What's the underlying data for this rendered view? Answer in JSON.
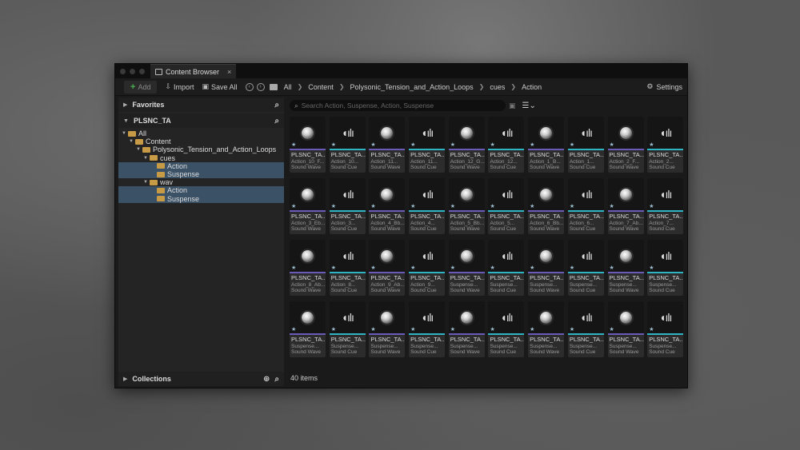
{
  "window": {
    "tab_title": "Content Browser",
    "tab_close": "×"
  },
  "toolbar": {
    "add_label": "Add",
    "import_label": "Import",
    "save_all_label": "Save All",
    "breadcrumbs": [
      "All",
      "Content",
      "Polysonic_Tension_and_Action_Loops",
      "cues",
      "Action"
    ],
    "settings_label": "Settings"
  },
  "left": {
    "favorites_label": "Favorites",
    "project_label": "PLSNC_TA",
    "tree": [
      {
        "label": "All",
        "depth": 0,
        "selected": false,
        "expanded": true
      },
      {
        "label": "Content",
        "depth": 1,
        "selected": false,
        "expanded": true
      },
      {
        "label": "Polysonic_Tension_and_Action_Loops",
        "depth": 2,
        "selected": false,
        "expanded": true
      },
      {
        "label": "cues",
        "depth": 3,
        "selected": false,
        "expanded": true
      },
      {
        "label": "Action",
        "depth": 4,
        "selected": true,
        "expanded": false
      },
      {
        "label": "Suspense",
        "depth": 4,
        "selected": true,
        "expanded": false
      },
      {
        "label": "wav",
        "depth": 3,
        "selected": false,
        "expanded": true
      },
      {
        "label": "Action",
        "depth": 4,
        "selected": true,
        "expanded": false
      },
      {
        "label": "Suspense",
        "depth": 4,
        "selected": true,
        "expanded": false
      }
    ],
    "collections_label": "Collections"
  },
  "search": {
    "placeholder": "Search Action, Suspense, Action, Suspense"
  },
  "status": {
    "items_count": "40 items"
  },
  "assets": [
    {
      "name": "PLSNC_TA...",
      "sub1": "Action_10_F...",
      "type": "Sound Wave",
      "kind": "wave"
    },
    {
      "name": "PLSNC_TA...",
      "sub1": "Action_10...",
      "type": "Sound Cue",
      "kind": "cue"
    },
    {
      "name": "PLSNC_TA...",
      "sub1": "Action_11...",
      "type": "Sound Wave",
      "kind": "wave"
    },
    {
      "name": "PLSNC_TA...",
      "sub1": "Action_11...",
      "type": "Sound Cue",
      "kind": "cue"
    },
    {
      "name": "PLSNC_TA...",
      "sub1": "Action_12_G...",
      "type": "Sound Wave",
      "kind": "wave"
    },
    {
      "name": "PLSNC_TA...",
      "sub1": "Action_12...",
      "type": "Sound Cue",
      "kind": "cue"
    },
    {
      "name": "PLSNC_TA...",
      "sub1": "Action_1_B...",
      "type": "Sound Wave",
      "kind": "wave"
    },
    {
      "name": "PLSNC_TA...",
      "sub1": "Action_1...",
      "type": "Sound Cue",
      "kind": "cue"
    },
    {
      "name": "PLSNC_TA...",
      "sub1": "Action_2_F...",
      "type": "Sound Wave",
      "kind": "wave"
    },
    {
      "name": "PLSNC_TA...",
      "sub1": "Action_2...",
      "type": "Sound Cue",
      "kind": "cue"
    },
    {
      "name": "PLSNC_TA...",
      "sub1": "Action_3_Eb...",
      "type": "Sound Wave",
      "kind": "wave"
    },
    {
      "name": "PLSNC_TA...",
      "sub1": "Action_3...",
      "type": "Sound Cue",
      "kind": "cue"
    },
    {
      "name": "PLSNC_TA...",
      "sub1": "Action_4_Bb...",
      "type": "Sound Wave",
      "kind": "wave"
    },
    {
      "name": "PLSNC_TA...",
      "sub1": "Action_4...",
      "type": "Sound Cue",
      "kind": "cue"
    },
    {
      "name": "PLSNC_TA...",
      "sub1": "Action_5_Bb...",
      "type": "Sound Wave",
      "kind": "wave"
    },
    {
      "name": "PLSNC_TA...",
      "sub1": "Action_5...",
      "type": "Sound Cue",
      "kind": "cue"
    },
    {
      "name": "PLSNC_TA...",
      "sub1": "Action_6_Bb...",
      "type": "Sound Wave",
      "kind": "wave"
    },
    {
      "name": "PLSNC_TA...",
      "sub1": "Action_6...",
      "type": "Sound Cue",
      "kind": "cue"
    },
    {
      "name": "PLSNC_TA...",
      "sub1": "Action_7_Ab...",
      "type": "Sound Wave",
      "kind": "wave"
    },
    {
      "name": "PLSNC_TA...",
      "sub1": "Action_7...",
      "type": "Sound Cue",
      "kind": "cue"
    },
    {
      "name": "PLSNC_TA...",
      "sub1": "Action_8_Ab...",
      "type": "Sound Wave",
      "kind": "wave"
    },
    {
      "name": "PLSNC_TA...",
      "sub1": "Action_8...",
      "type": "Sound Cue",
      "kind": "cue"
    },
    {
      "name": "PLSNC_TA...",
      "sub1": "Action_9_Ab...",
      "type": "Sound Wave",
      "kind": "wave"
    },
    {
      "name": "PLSNC_TA...",
      "sub1": "Action_9...",
      "type": "Sound Cue",
      "kind": "cue"
    },
    {
      "name": "PLSNC_TA...",
      "sub1": "Suspense...",
      "type": "Sound Wave",
      "kind": "wave"
    },
    {
      "name": "PLSNC_TA...",
      "sub1": "Suspense...",
      "type": "Sound Cue",
      "kind": "cue"
    },
    {
      "name": "PLSNC_TA...",
      "sub1": "Suspense...",
      "type": "Sound Wave",
      "kind": "wave"
    },
    {
      "name": "PLSNC_TA...",
      "sub1": "Suspense...",
      "type": "Sound Cue",
      "kind": "cue"
    },
    {
      "name": "PLSNC_TA...",
      "sub1": "Suspense...",
      "type": "Sound Wave",
      "kind": "wave"
    },
    {
      "name": "PLSNC_TA...",
      "sub1": "Suspense...",
      "type": "Sound Cue",
      "kind": "cue"
    },
    {
      "name": "PLSNC_TA...",
      "sub1": "Suspense...",
      "type": "Sound Wave",
      "kind": "wave"
    },
    {
      "name": "PLSNC_TA...",
      "sub1": "Suspense...",
      "type": "Sound Cue",
      "kind": "cue"
    },
    {
      "name": "PLSNC_TA...",
      "sub1": "Suspense...",
      "type": "Sound Wave",
      "kind": "wave"
    },
    {
      "name": "PLSNC_TA...",
      "sub1": "Suspense...",
      "type": "Sound Cue",
      "kind": "cue"
    },
    {
      "name": "PLSNC_TA...",
      "sub1": "Suspense...",
      "type": "Sound Wave",
      "kind": "wave"
    },
    {
      "name": "PLSNC_TA...",
      "sub1": "Suspense...",
      "type": "Sound Cue",
      "kind": "cue"
    },
    {
      "name": "PLSNC_TA...",
      "sub1": "Suspense...",
      "type": "Sound Wave",
      "kind": "wave"
    },
    {
      "name": "PLSNC_TA...",
      "sub1": "Suspense...",
      "type": "Sound Cue",
      "kind": "cue"
    },
    {
      "name": "PLSNC_TA...",
      "sub1": "Suspense...",
      "type": "Sound Wave",
      "kind": "wave"
    },
    {
      "name": "PLSNC_TA...",
      "sub1": "Suspense...",
      "type": "Sound Cue",
      "kind": "cue"
    }
  ]
}
